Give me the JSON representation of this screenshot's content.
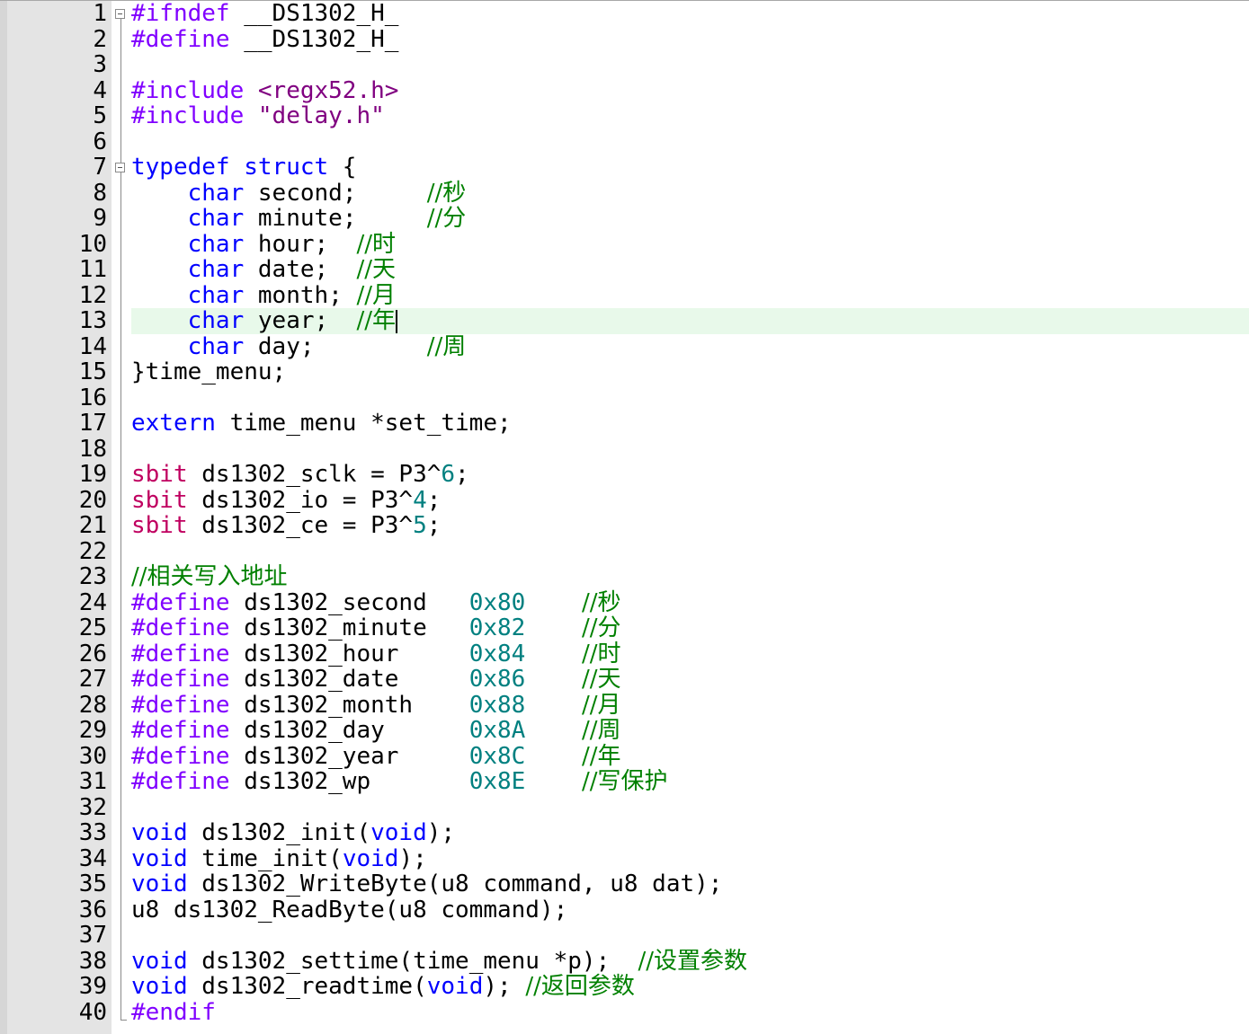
{
  "editor": {
    "current_line": 13,
    "lines": [
      {
        "n": "1",
        "tokens": [
          {
            "t": "#ifndef",
            "c": "pp"
          },
          {
            "t": " __DS1302_H_",
            "c": "id"
          }
        ]
      },
      {
        "n": "2",
        "tokens": [
          {
            "t": "#define",
            "c": "pp"
          },
          {
            "t": " __DS1302_H_",
            "c": "id"
          }
        ]
      },
      {
        "n": "3",
        "tokens": []
      },
      {
        "n": "4",
        "tokens": [
          {
            "t": "#include",
            "c": "pp"
          },
          {
            "t": " <regx52.h>",
            "c": "str"
          }
        ]
      },
      {
        "n": "5",
        "tokens": [
          {
            "t": "#include",
            "c": "pp"
          },
          {
            "t": " \"delay.h\"",
            "c": "str"
          }
        ]
      },
      {
        "n": "6",
        "tokens": []
      },
      {
        "n": "7",
        "tokens": [
          {
            "t": "typedef",
            "c": "kw"
          },
          {
            "t": " ",
            "c": "id"
          },
          {
            "t": "struct",
            "c": "kw"
          },
          {
            "t": " {",
            "c": "op"
          }
        ]
      },
      {
        "n": "8",
        "tokens": [
          {
            "t": "    ",
            "c": "id"
          },
          {
            "t": "char",
            "c": "kw"
          },
          {
            "t": " second;     ",
            "c": "id"
          },
          {
            "t": "//秒",
            "c": "cm"
          }
        ]
      },
      {
        "n": "9",
        "tokens": [
          {
            "t": "    ",
            "c": "id"
          },
          {
            "t": "char",
            "c": "kw"
          },
          {
            "t": " minute;     ",
            "c": "id"
          },
          {
            "t": "//分",
            "c": "cm"
          }
        ]
      },
      {
        "n": "10",
        "tokens": [
          {
            "t": "    ",
            "c": "id"
          },
          {
            "t": "char",
            "c": "kw"
          },
          {
            "t": " hour;  ",
            "c": "id"
          },
          {
            "t": "//时",
            "c": "cm"
          }
        ]
      },
      {
        "n": "11",
        "tokens": [
          {
            "t": "    ",
            "c": "id"
          },
          {
            "t": "char",
            "c": "kw"
          },
          {
            "t": " date;  ",
            "c": "id"
          },
          {
            "t": "//天",
            "c": "cm"
          }
        ]
      },
      {
        "n": "12",
        "tokens": [
          {
            "t": "    ",
            "c": "id"
          },
          {
            "t": "char",
            "c": "kw"
          },
          {
            "t": " month; ",
            "c": "id"
          },
          {
            "t": "//月",
            "c": "cm"
          }
        ]
      },
      {
        "n": "13",
        "tokens": [
          {
            "t": "    ",
            "c": "id"
          },
          {
            "t": "char",
            "c": "kw"
          },
          {
            "t": " year;  ",
            "c": "id"
          },
          {
            "t": "//年",
            "c": "cm"
          }
        ]
      },
      {
        "n": "14",
        "tokens": [
          {
            "t": "    ",
            "c": "id"
          },
          {
            "t": "char",
            "c": "kw"
          },
          {
            "t": " day;        ",
            "c": "id"
          },
          {
            "t": "//周",
            "c": "cm"
          }
        ]
      },
      {
        "n": "15",
        "tokens": [
          {
            "t": "}time_menu;",
            "c": "id"
          }
        ]
      },
      {
        "n": "16",
        "tokens": []
      },
      {
        "n": "17",
        "tokens": [
          {
            "t": "extern",
            "c": "kw"
          },
          {
            "t": " time_menu *set_time;",
            "c": "id"
          }
        ]
      },
      {
        "n": "18",
        "tokens": []
      },
      {
        "n": "19",
        "tokens": [
          {
            "t": "sbit",
            "c": "sbit"
          },
          {
            "t": " ds1302_sclk = P3^",
            "c": "id"
          },
          {
            "t": "6",
            "c": "num"
          },
          {
            "t": ";",
            "c": "op"
          }
        ]
      },
      {
        "n": "20",
        "tokens": [
          {
            "t": "sbit",
            "c": "sbit"
          },
          {
            "t": " ds1302_io = P3^",
            "c": "id"
          },
          {
            "t": "4",
            "c": "num"
          },
          {
            "t": ";",
            "c": "op"
          }
        ]
      },
      {
        "n": "21",
        "tokens": [
          {
            "t": "sbit",
            "c": "sbit"
          },
          {
            "t": " ds1302_ce = P3^",
            "c": "id"
          },
          {
            "t": "5",
            "c": "num"
          },
          {
            "t": ";",
            "c": "op"
          }
        ]
      },
      {
        "n": "22",
        "tokens": []
      },
      {
        "n": "23",
        "tokens": [
          {
            "t": "//相关写入地址",
            "c": "cm"
          }
        ]
      },
      {
        "n": "24",
        "tokens": [
          {
            "t": "#define",
            "c": "pp"
          },
          {
            "t": " ds1302_second   ",
            "c": "id"
          },
          {
            "t": "0x80",
            "c": "num"
          },
          {
            "t": "    ",
            "c": "id"
          },
          {
            "t": "//秒",
            "c": "cm"
          }
        ]
      },
      {
        "n": "25",
        "tokens": [
          {
            "t": "#define",
            "c": "pp"
          },
          {
            "t": " ds1302_minute   ",
            "c": "id"
          },
          {
            "t": "0x82",
            "c": "num"
          },
          {
            "t": "    ",
            "c": "id"
          },
          {
            "t": "//分",
            "c": "cm"
          }
        ]
      },
      {
        "n": "26",
        "tokens": [
          {
            "t": "#define",
            "c": "pp"
          },
          {
            "t": " ds1302_hour     ",
            "c": "id"
          },
          {
            "t": "0x84",
            "c": "num"
          },
          {
            "t": "    ",
            "c": "id"
          },
          {
            "t": "//时",
            "c": "cm"
          }
        ]
      },
      {
        "n": "27",
        "tokens": [
          {
            "t": "#define",
            "c": "pp"
          },
          {
            "t": " ds1302_date     ",
            "c": "id"
          },
          {
            "t": "0x86",
            "c": "num"
          },
          {
            "t": "    ",
            "c": "id"
          },
          {
            "t": "//天",
            "c": "cm"
          }
        ]
      },
      {
        "n": "28",
        "tokens": [
          {
            "t": "#define",
            "c": "pp"
          },
          {
            "t": " ds1302_month    ",
            "c": "id"
          },
          {
            "t": "0x88",
            "c": "num"
          },
          {
            "t": "    ",
            "c": "id"
          },
          {
            "t": "//月",
            "c": "cm"
          }
        ]
      },
      {
        "n": "29",
        "tokens": [
          {
            "t": "#define",
            "c": "pp"
          },
          {
            "t": " ds1302_day      ",
            "c": "id"
          },
          {
            "t": "0x8A",
            "c": "num"
          },
          {
            "t": "    ",
            "c": "id"
          },
          {
            "t": "//周",
            "c": "cm"
          }
        ]
      },
      {
        "n": "30",
        "tokens": [
          {
            "t": "#define",
            "c": "pp"
          },
          {
            "t": " ds1302_year     ",
            "c": "id"
          },
          {
            "t": "0x8C",
            "c": "num"
          },
          {
            "t": "    ",
            "c": "id"
          },
          {
            "t": "//年",
            "c": "cm"
          }
        ]
      },
      {
        "n": "31",
        "tokens": [
          {
            "t": "#define",
            "c": "pp"
          },
          {
            "t": " ds1302_wp       ",
            "c": "id"
          },
          {
            "t": "0x8E",
            "c": "num"
          },
          {
            "t": "    ",
            "c": "id"
          },
          {
            "t": "//写保护",
            "c": "cm"
          }
        ]
      },
      {
        "n": "32",
        "tokens": []
      },
      {
        "n": "33",
        "tokens": [
          {
            "t": "void",
            "c": "kw"
          },
          {
            "t": " ds1302_init(",
            "c": "id"
          },
          {
            "t": "void",
            "c": "kw"
          },
          {
            "t": ");",
            "c": "op"
          }
        ]
      },
      {
        "n": "34",
        "tokens": [
          {
            "t": "void",
            "c": "kw"
          },
          {
            "t": " time_init(",
            "c": "id"
          },
          {
            "t": "void",
            "c": "kw"
          },
          {
            "t": ");",
            "c": "op"
          }
        ]
      },
      {
        "n": "35",
        "tokens": [
          {
            "t": "void",
            "c": "kw"
          },
          {
            "t": " ds1302_WriteByte(u8 command, u8 dat);",
            "c": "id"
          }
        ]
      },
      {
        "n": "36",
        "tokens": [
          {
            "t": "u8 ds1302_ReadByte(u8 command);",
            "c": "id"
          }
        ]
      },
      {
        "n": "37",
        "tokens": []
      },
      {
        "n": "38",
        "tokens": [
          {
            "t": "void",
            "c": "kw"
          },
          {
            "t": " ds1302_settime(time_menu *p);  ",
            "c": "id"
          },
          {
            "t": "//设置参数",
            "c": "cm"
          }
        ]
      },
      {
        "n": "39",
        "tokens": [
          {
            "t": "void",
            "c": "kw"
          },
          {
            "t": " ds1302_readtime(",
            "c": "id"
          },
          {
            "t": "void",
            "c": "kw"
          },
          {
            "t": "); ",
            "c": "op"
          },
          {
            "t": "//返回参数",
            "c": "cm"
          }
        ]
      },
      {
        "n": "40",
        "tokens": [
          {
            "t": "#endif",
            "c": "pp"
          }
        ]
      }
    ]
  }
}
